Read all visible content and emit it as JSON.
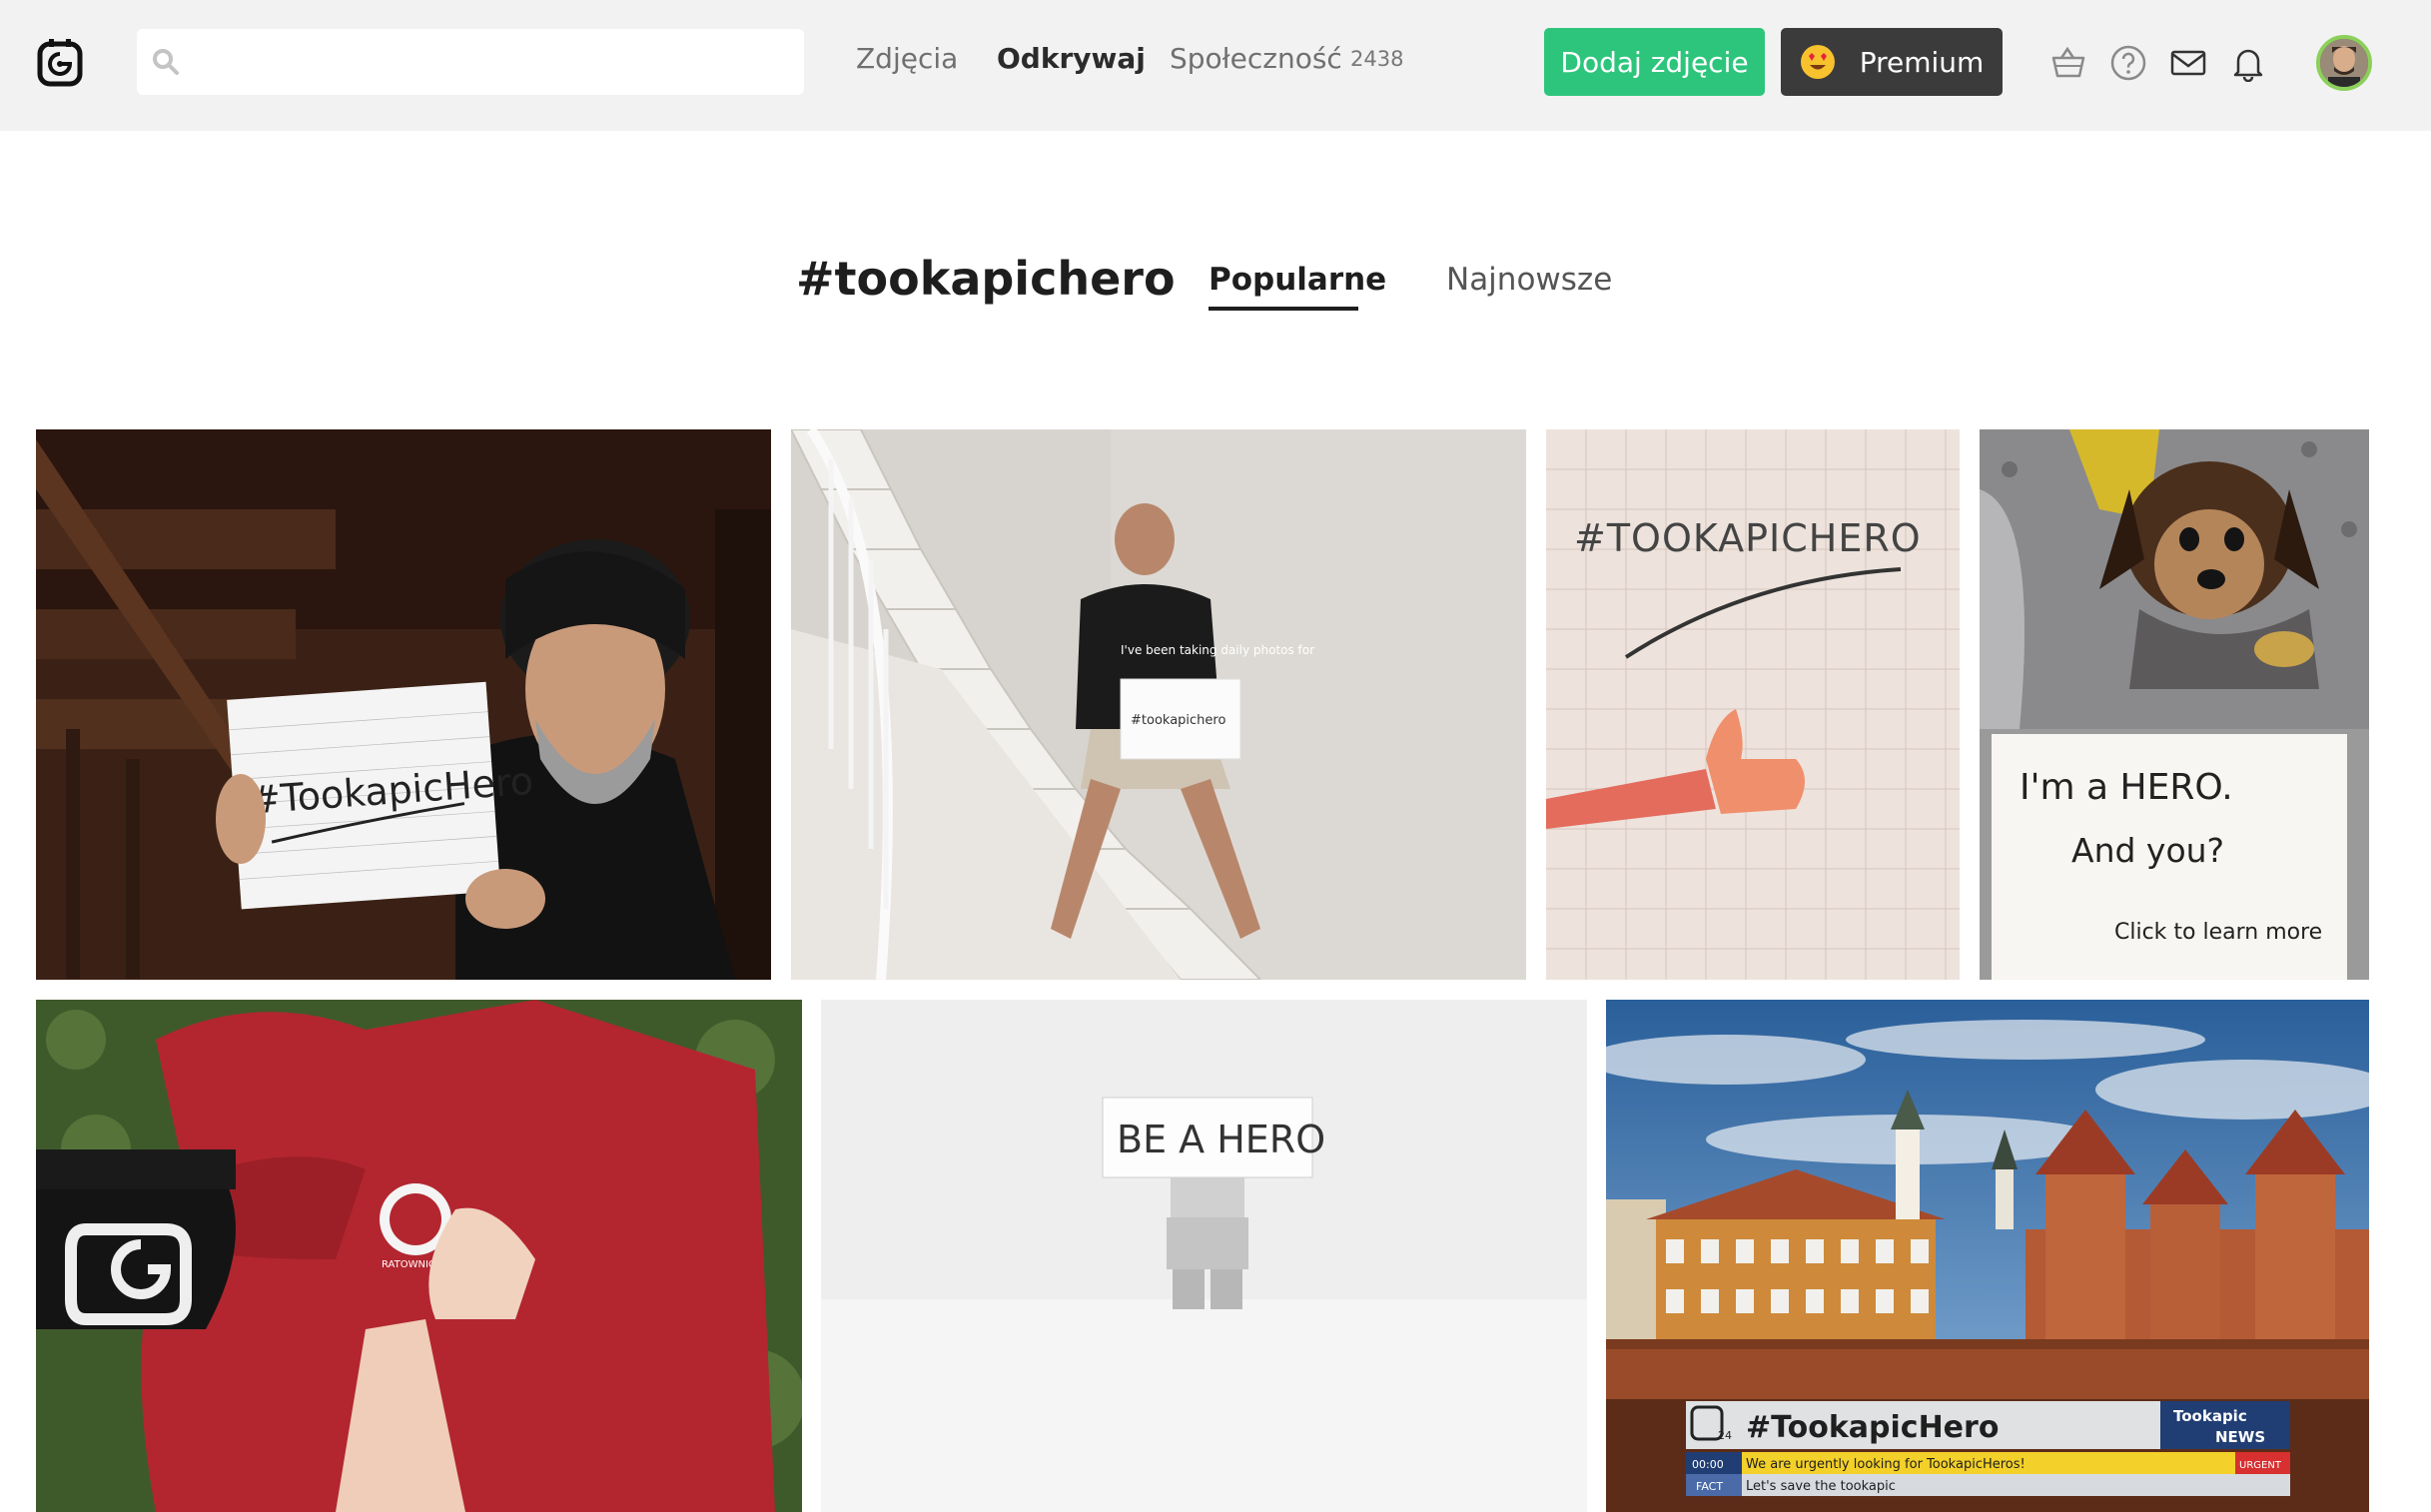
{
  "header": {
    "search": {
      "placeholder": "",
      "value": ""
    },
    "nav": [
      {
        "label": "Zdjęcia"
      },
      {
        "label": "Odkrywaj"
      },
      {
        "label": "Społeczność",
        "count": "2438"
      }
    ],
    "add_photo_label": "Dodaj zdjęcie",
    "premium_label": "Premium",
    "icons": [
      "basket-icon",
      "help-icon",
      "mail-icon",
      "bell-icon"
    ]
  },
  "page": {
    "hashtag": "#tookapichero",
    "tabs": [
      {
        "label": "Popularne",
        "active": true
      },
      {
        "label": "Najnowsze",
        "active": false
      }
    ]
  },
  "photos": [
    {
      "sign": "#TookapicHero"
    },
    {
      "shirt": "I've been taking daily photos for",
      "sign": "#tookapichero"
    },
    {
      "sign": "#TOOKAPICHERO"
    },
    {
      "sign_line1": "I'm a HERO.",
      "sign_line2": "And you?",
      "sign_line3": "Click to learn more"
    },
    {
      "badge": "RATOWNICTWO"
    },
    {
      "sign": "BE A HERO"
    },
    {
      "ticker": {
        "title": "#TookapicHero",
        "brand_top": "Tookapic",
        "brand_bottom": "NEWS",
        "time": "00:00",
        "headline": "We are urgently looking for TookapicHeros!",
        "urgent": "URGENT",
        "fact_label": "FACT",
        "fact": "Let's save the tookapic",
        "channel": "24"
      }
    }
  ],
  "colors": {
    "accent_green": "#2dc57c",
    "premium_dark": "#3b3b3b",
    "header_bg": "#f2f2f2"
  }
}
